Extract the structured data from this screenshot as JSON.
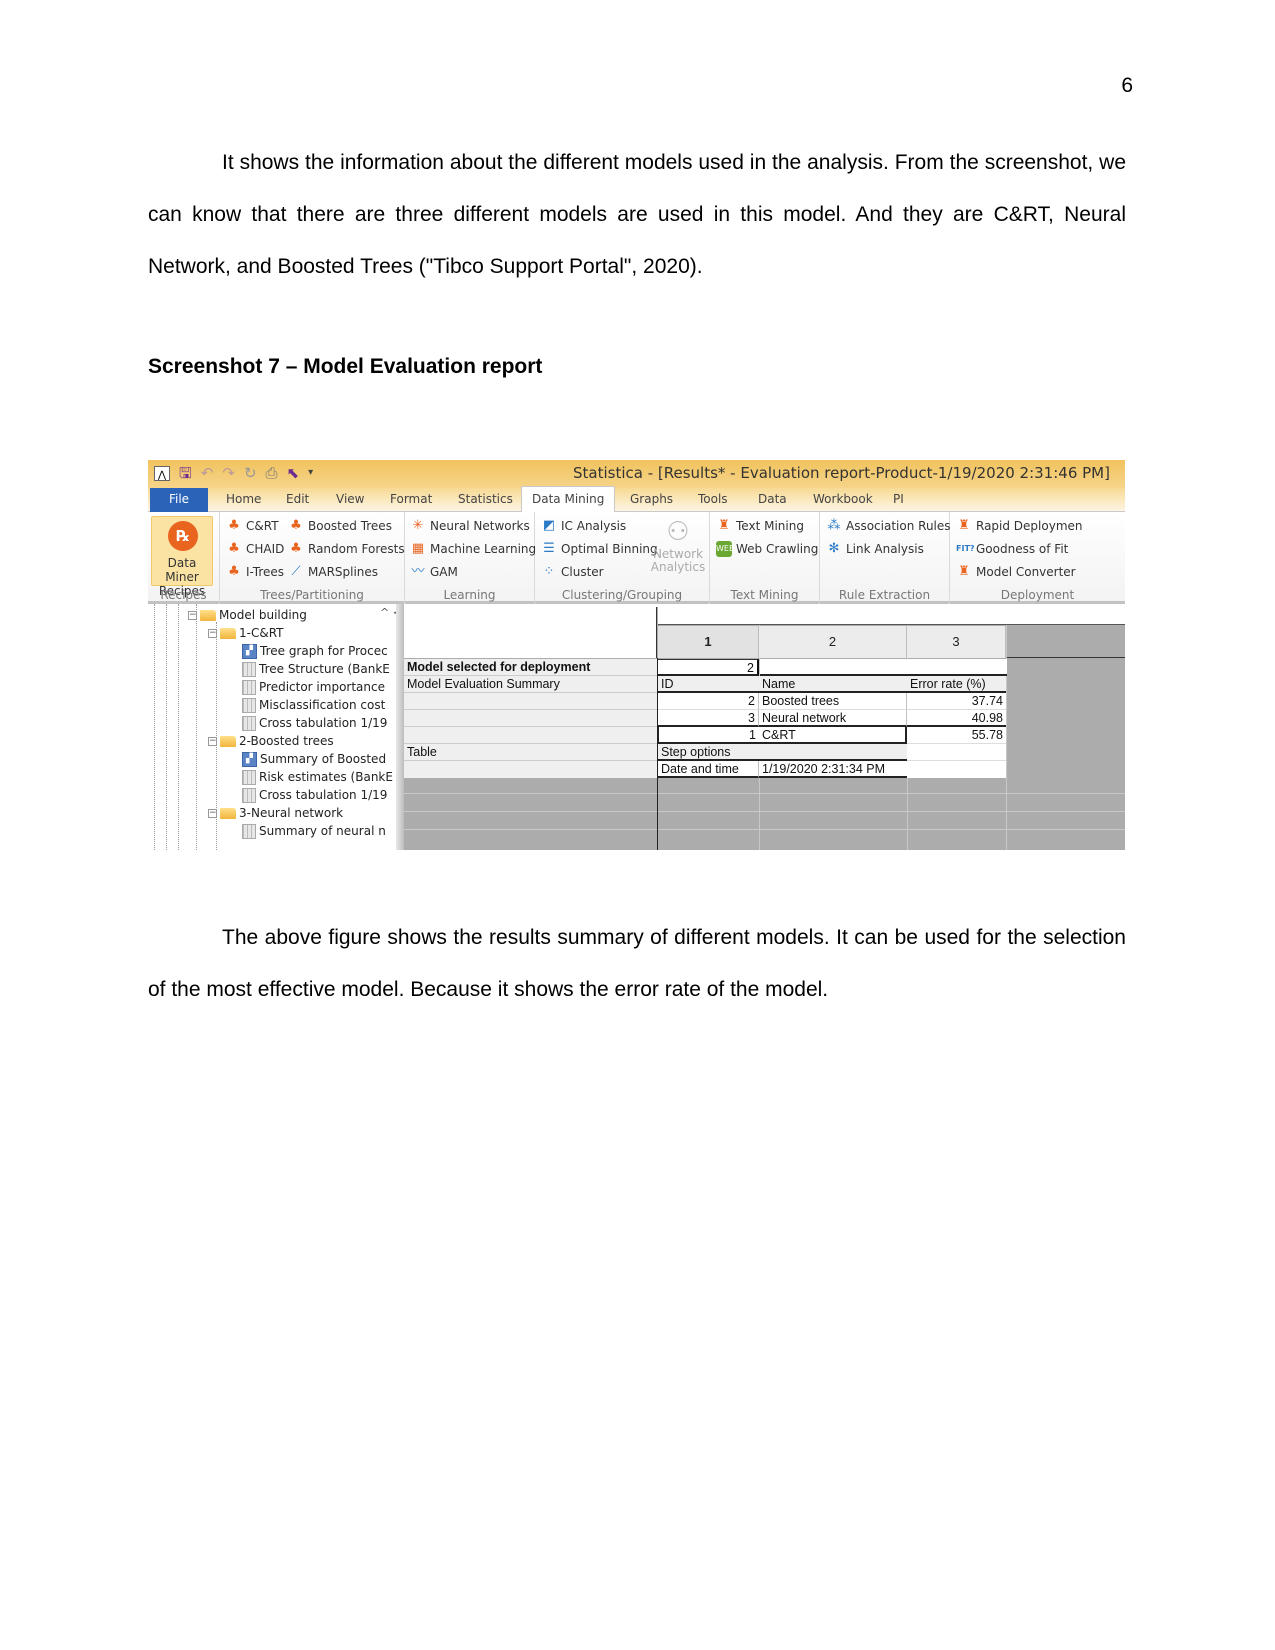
{
  "page": {
    "number": "6",
    "paragraph1": "It shows the information about the different models used in the analysis. From the screenshot, we can know that there are three different models are used in this model. And they are C&RT, Neural Network, and Boosted Trees (\"Tibco Support Portal\", 2020).",
    "heading": "Screenshot 7 – Model Evaluation report",
    "paragraph2": "The above figure shows the results summary of different models. It can be used for the selection of the most effective model. Because it shows the error rate of the model."
  },
  "app": {
    "title": "Statistica - [Results* - Evaluation report-Product-1/19/2020 2:31:46 PM]",
    "quick_access": [
      "app-icon",
      "save-icon",
      "undo-icon",
      "redo-icon",
      "refresh-icon",
      "print-icon",
      "select-icon",
      "customize-icon"
    ],
    "tabs": [
      "File",
      "Home",
      "Edit",
      "View",
      "Format",
      "Statistics",
      "Data Mining",
      "Graphs",
      "Tools",
      "Data",
      "Workbook",
      "PI"
    ],
    "active_tab": "Data Mining",
    "ribbon": {
      "recipes": {
        "button": "Data Miner Recipes",
        "button_line1": "Data Miner",
        "button_line2": "Recipes",
        "label": "Recipes"
      },
      "trees": {
        "items": [
          "C&RT",
          "Boosted Trees",
          "CHAID",
          "Random Forests",
          "I-Trees",
          "MARSplines"
        ],
        "label": "Trees/Partitioning"
      },
      "learning": {
        "items": [
          "Neural Networks",
          "Machine Learning",
          "GAM"
        ],
        "label": "Learning"
      },
      "clustering": {
        "items": [
          "IC Analysis",
          "Optimal Binning",
          "Cluster"
        ],
        "network_line1": "Network",
        "network_line2": "Analytics",
        "label": "Clustering/Grouping"
      },
      "text_mining": {
        "items": [
          "Text Mining",
          "Web Crawling"
        ],
        "label": "Text Mining"
      },
      "rule_extraction": {
        "items": [
          "Association Rules",
          "Link Analysis"
        ],
        "label": "Rule Extraction"
      },
      "deployment": {
        "items": [
          "Rapid Deploymen",
          "Goodness of Fit",
          "Model Converter"
        ],
        "label": "Deployment"
      }
    }
  },
  "tree": {
    "items": [
      {
        "label": "Model building",
        "type": "folder",
        "level": 0
      },
      {
        "label": "1-C&RT",
        "type": "folder",
        "level": 1
      },
      {
        "label": "Tree graph for Procec",
        "type": "graph",
        "level": 2
      },
      {
        "label": "Tree Structure (BankE",
        "type": "sheet",
        "level": 2
      },
      {
        "label": "Predictor importance",
        "type": "sheet",
        "level": 2
      },
      {
        "label": "Misclassification cost",
        "type": "sheet",
        "level": 2
      },
      {
        "label": "Cross tabulation 1/19",
        "type": "sheet",
        "level": 2
      },
      {
        "label": "2-Boosted trees",
        "type": "folder",
        "level": 1
      },
      {
        "label": "Summary of Boosted",
        "type": "graph",
        "level": 2
      },
      {
        "label": "Risk estimates (BankE",
        "type": "sheet",
        "level": 2
      },
      {
        "label": "Cross tabulation 1/19",
        "type": "sheet",
        "level": 2
      },
      {
        "label": "3-Neural network",
        "type": "folder",
        "level": 1
      },
      {
        "label": "Summary of neural n",
        "type": "sheet",
        "level": 2
      }
    ]
  },
  "sheet": {
    "columns": [
      "1",
      "2",
      "3"
    ],
    "model_selected_label": "Model selected for deployment",
    "model_selected_value": "2",
    "summary_label": "Model Evaluation Summary",
    "summary_headers": [
      "ID",
      "Name",
      "Error rate (%)"
    ],
    "summary_rows": [
      {
        "id": "2",
        "name": "Boosted trees",
        "error_rate": "37.74"
      },
      {
        "id": "3",
        "name": "Neural network",
        "error_rate": "40.98"
      },
      {
        "id": "1",
        "name": "C&RT",
        "error_rate": "55.78"
      }
    ],
    "table_label": "Table",
    "step_options": "Step options",
    "date_label": "Date and time",
    "date_value": "1/19/2020 2:31:34 PM"
  }
}
